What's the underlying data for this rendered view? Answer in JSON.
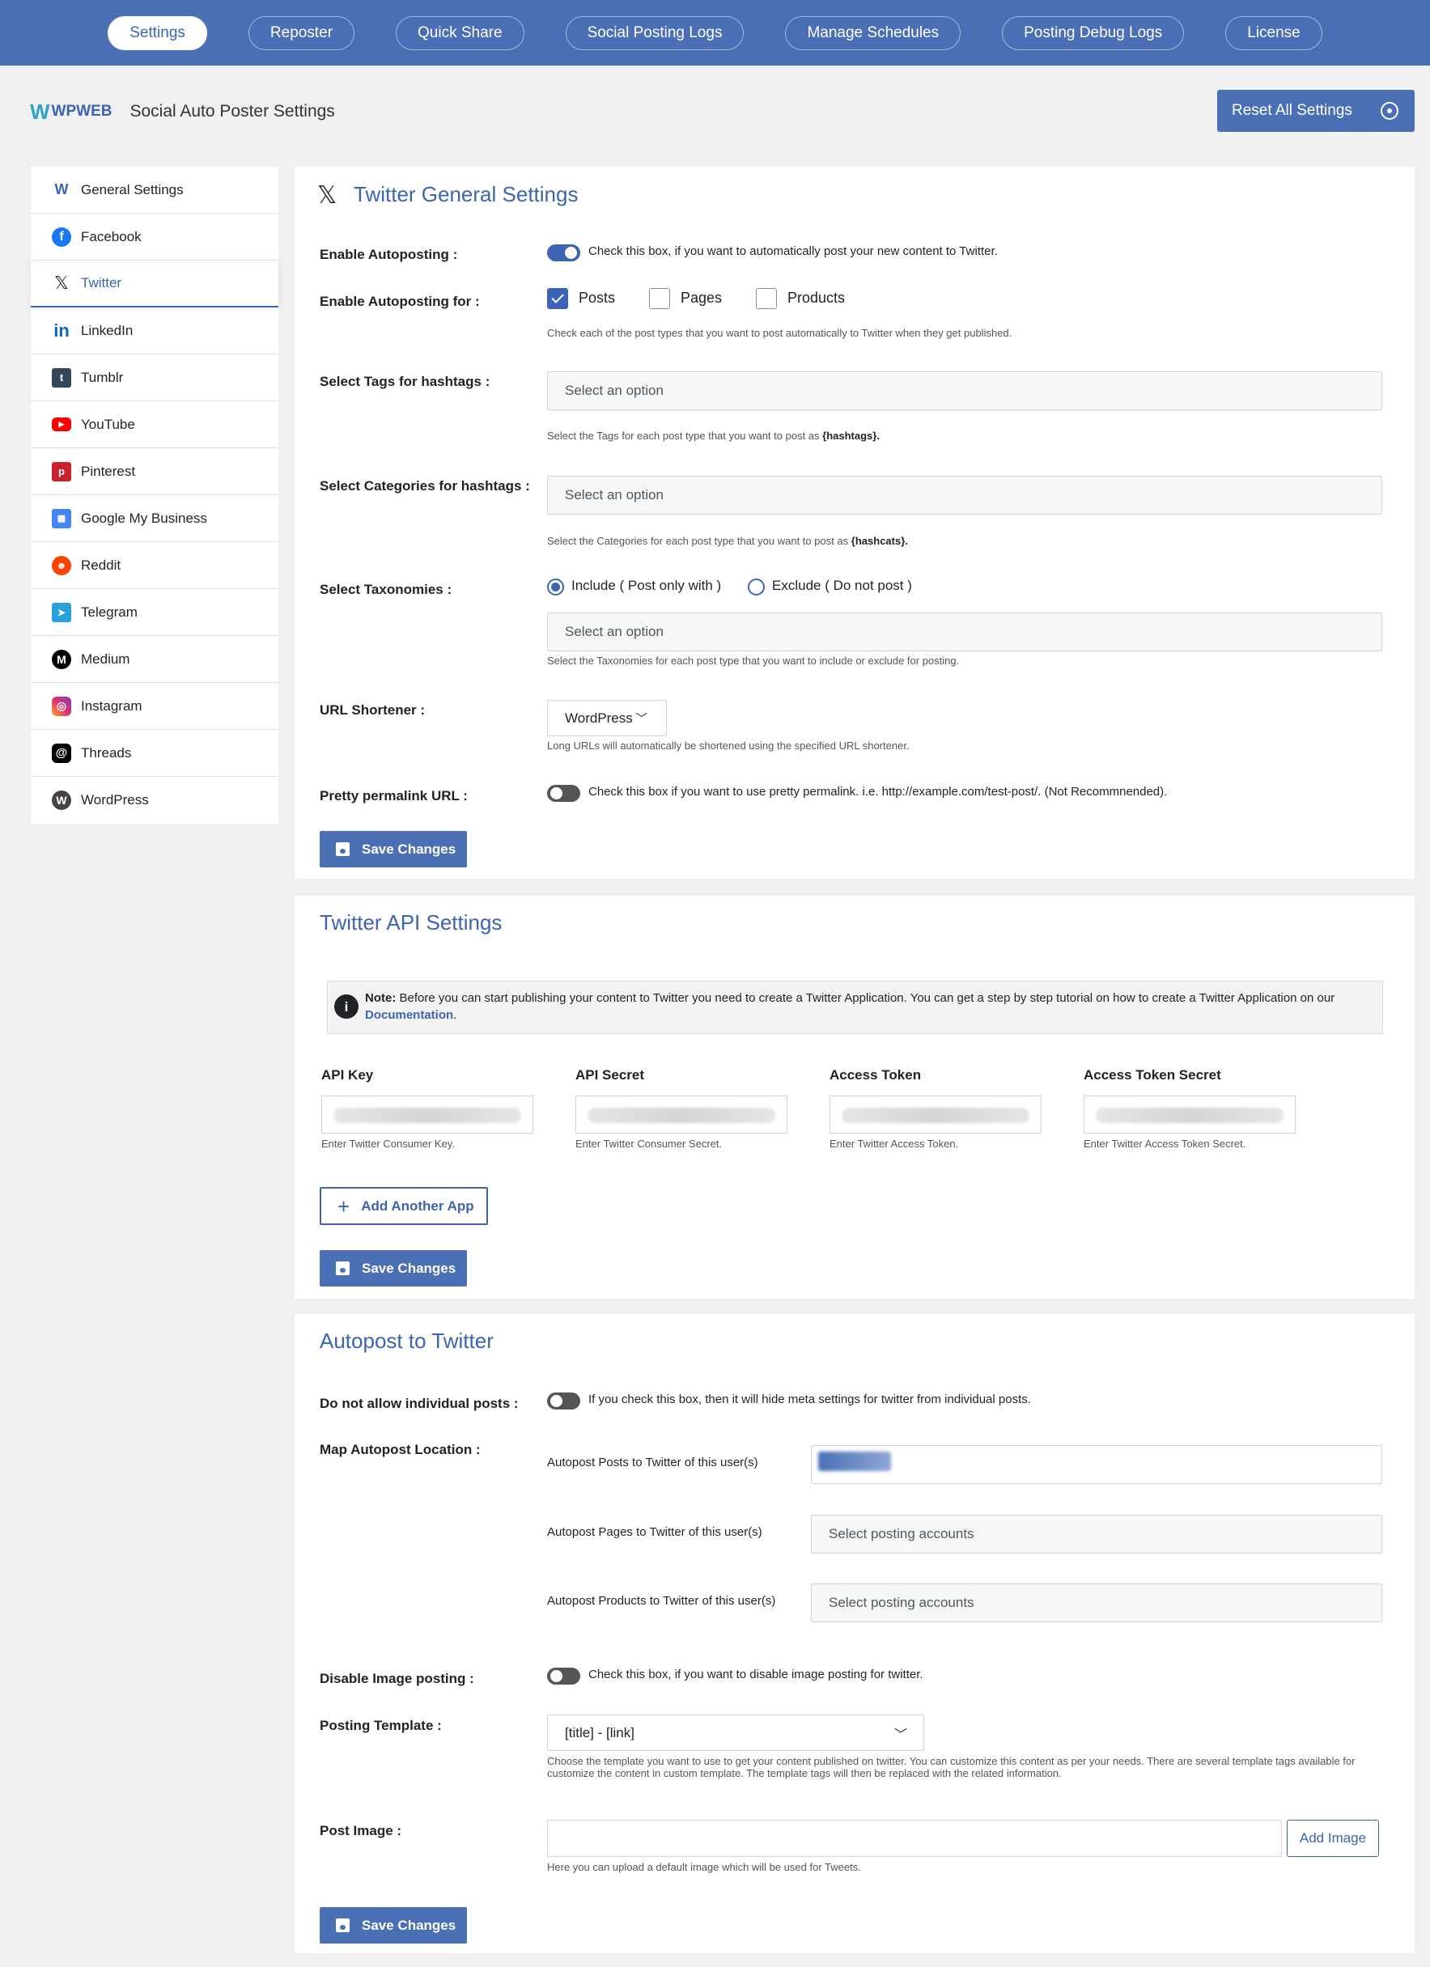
{
  "nav": {
    "tabs": [
      {
        "label": "Settings"
      },
      {
        "label": "Reposter"
      },
      {
        "label": "Quick Share"
      },
      {
        "label": "Social Posting Logs"
      },
      {
        "label": "Manage Schedules"
      },
      {
        "label": "Posting Debug Logs"
      },
      {
        "label": "License"
      }
    ]
  },
  "header": {
    "logo_text": "WPWEB",
    "title": "Social Auto Poster Settings",
    "reset_label": "Reset All Settings"
  },
  "sidebar": {
    "items": [
      {
        "label": "General Settings",
        "icon": "wpweb-icon"
      },
      {
        "label": "Facebook",
        "icon": "facebook-icon"
      },
      {
        "label": "Twitter",
        "icon": "x-icon"
      },
      {
        "label": "LinkedIn",
        "icon": "linkedin-icon"
      },
      {
        "label": "Tumblr",
        "icon": "tumblr-icon"
      },
      {
        "label": "YouTube",
        "icon": "youtube-icon"
      },
      {
        "label": "Pinterest",
        "icon": "pinterest-icon"
      },
      {
        "label": "Google My Business",
        "icon": "google-my-business-icon"
      },
      {
        "label": "Reddit",
        "icon": "reddit-icon"
      },
      {
        "label": "Telegram",
        "icon": "telegram-icon"
      },
      {
        "label": "Medium",
        "icon": "medium-icon"
      },
      {
        "label": "Instagram",
        "icon": "instagram-icon"
      },
      {
        "label": "Threads",
        "icon": "threads-icon"
      },
      {
        "label": "WordPress",
        "icon": "wordpress-icon"
      }
    ]
  },
  "general": {
    "title": "Twitter General Settings",
    "enable_label": "Enable Autoposting :",
    "enable_desc": "Check this box, if you want to automatically post your new content to Twitter.",
    "enable_for_label": "Enable Autoposting for :",
    "post_types": [
      "Posts",
      "Pages",
      "Products"
    ],
    "post_types_desc": "Check each of the post types that you want to post automatically to Twitter when they get published.",
    "tags_label": "Select Tags for hashtags :",
    "tags_placeholder": "Select an option",
    "tags_desc": "Select the Tags for each post type that you want to post as",
    "tags_token": "{hashtags}.",
    "cats_label": "Select Categories for hashtags :",
    "cats_placeholder": "Select an option",
    "cats_desc": "Select the Categories for each post type that you want to post as",
    "cats_token": "{hashcats}.",
    "tax_label": "Select Taxonomies :",
    "tax_include": "Include ( Post only with )",
    "tax_exclude": "Exclude ( Do not post )",
    "tax_placeholder": "Select an option",
    "tax_desc": "Select the Taxonomies for each post type that you want to include or exclude for posting.",
    "url_label": "URL Shortener :",
    "url_value": "WordPress",
    "url_desc": "Long URLs will automatically be shortened using the specified URL shortener.",
    "pretty_label": "Pretty permalink URL :",
    "pretty_desc": "Check this box if you want to use pretty permalink. i.e. http://example.com/test-post/. (Not Recommnended).",
    "save_label": "Save Changes"
  },
  "api": {
    "title": "Twitter API Settings",
    "note_bold": "Note:",
    "note_text": " Before you can start publishing your content to Twitter you need to create a Twitter Application. You can get a step by step tutorial on how to create a Twitter Application on our",
    "note_link": "Documentation",
    "note_end": ".",
    "fields": [
      {
        "label": "API Key",
        "hint": "Enter Twitter Consumer Key."
      },
      {
        "label": "API Secret",
        "hint": "Enter Twitter Consumer Secret."
      },
      {
        "label": "Access Token",
        "hint": "Enter Twitter Access Token."
      },
      {
        "label": "Access Token Secret",
        "hint": "Enter Twitter Access Token Secret."
      }
    ],
    "add_app_label": "Add Another App",
    "save_label": "Save Changes"
  },
  "autopost": {
    "title": "Autopost to Twitter",
    "no_individual_label": "Do not allow individual posts :",
    "no_individual_desc": "If you check this box, then it will hide meta settings for twitter from individual posts.",
    "map_label": "Map Autopost Location :",
    "map_rows": [
      {
        "label": "Autopost Posts to Twitter of this user(s)",
        "placeholder": ""
      },
      {
        "label": "Autopost Pages to Twitter of this user(s)",
        "placeholder": "Select posting accounts"
      },
      {
        "label": "Autopost Products to Twitter of this user(s)",
        "placeholder": "Select posting accounts"
      }
    ],
    "disable_image_label": "Disable Image posting :",
    "disable_image_desc": "Check this box, if you want to disable image posting for twitter.",
    "template_label": "Posting Template :",
    "template_value": "[title] - [link]",
    "template_desc": "Choose the template you want to use to get your content published on twitter. You can customize this content as per your needs. There are several template tags available for customize the content in custom template. The template tags will then be replaced with the related information.",
    "image_label": "Post Image :",
    "add_image_label": "Add Image",
    "image_desc": "Here you can upload a default image which will be used for Tweets.",
    "save_label": "Save Changes"
  }
}
